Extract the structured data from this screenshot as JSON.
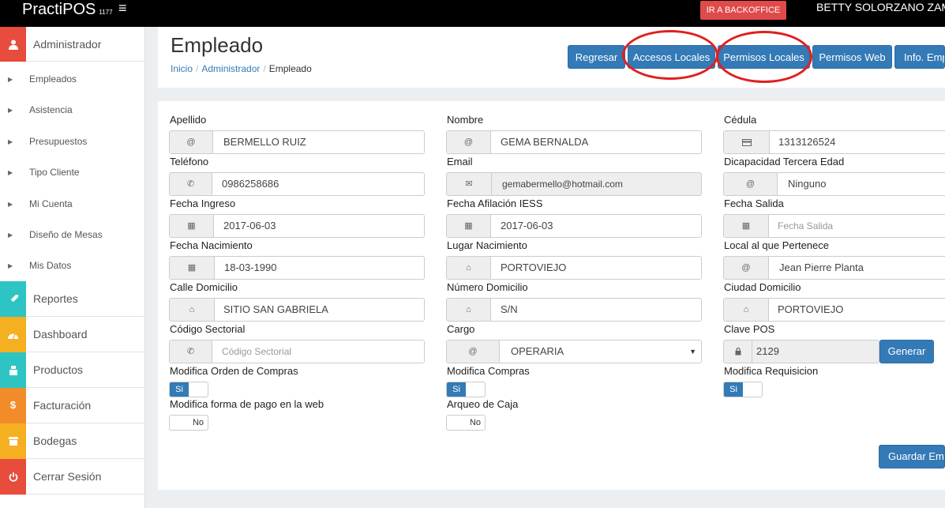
{
  "topbar": {
    "brand": "PractiPOS",
    "version": "1177",
    "menu_icon": "hamburger-icon",
    "backoffice_label": "IR A BACKOFFICE",
    "user_name": "BETTY SOLORZANO ZAM"
  },
  "sidebar": {
    "admin": {
      "label": "Administrador",
      "icon": "user-icon",
      "color": "#e74c3c"
    },
    "subitems": [
      "Empleados",
      "Asistencia",
      "Presupuestos",
      "Tipo Cliente",
      "Mi Cuenta",
      "Diseño de Mesas",
      "Mis Datos"
    ],
    "items": [
      {
        "label": "Reportes",
        "icon": "rocket-icon",
        "color": "#2ec4c4"
      },
      {
        "label": "Dashboard",
        "icon": "dashboard-icon",
        "color": "#f5b021"
      },
      {
        "label": "Productos",
        "icon": "product-icon",
        "color": "#2ec4c4"
      },
      {
        "label": "Facturación",
        "icon": "dollar-icon",
        "color": "#f28c2b"
      },
      {
        "label": "Bodegas",
        "icon": "warehouse-icon",
        "color": "#f5b021"
      },
      {
        "label": "Cerrar Sesión",
        "icon": "power-icon",
        "color": "#e74c3c"
      }
    ]
  },
  "page": {
    "title": "Empleado",
    "breadcrumb": {
      "home": "Inicio",
      "section": "Administrador",
      "current": "Empleado"
    }
  },
  "toolbar": {
    "regresar": "Regresar",
    "accesos": "Accesos Locales",
    "permisos_locales": "Permisos Locales",
    "permisos_web": "Permisos Web",
    "info": "Info. Emp"
  },
  "form": {
    "apellido": {
      "label": "Apellido",
      "value": "BERMELLO RUIZ",
      "icon": "at-icon"
    },
    "nombre": {
      "label": "Nombre",
      "value": "GEMA BERNALDA",
      "icon": "at-icon"
    },
    "cedula": {
      "label": "Cédula",
      "value": "1313126524",
      "icon": "id-card-icon"
    },
    "telefono": {
      "label": "Teléfono",
      "value": "0986258686",
      "icon": "phone-icon"
    },
    "email": {
      "label": "Email",
      "value": "gemabermello@hotmail.com",
      "icon": "envelope-icon"
    },
    "discapacidad": {
      "label": "Dicapacidad Tercera Edad",
      "value": "Ninguno",
      "icon": "at-icon"
    },
    "fecha_ingreso": {
      "label": "Fecha Ingreso",
      "value": "2017-06-03",
      "icon": "calendar-icon"
    },
    "fecha_iess": {
      "label": "Fecha Afilación IESS",
      "value": "2017-06-03",
      "icon": "calendar-icon"
    },
    "fecha_salida": {
      "label": "Fecha Salida",
      "placeholder": "Fecha Salida",
      "icon": "calendar-icon"
    },
    "fecha_nacimiento": {
      "label": "Fecha Nacimiento",
      "value": "18-03-1990",
      "icon": "calendar-icon"
    },
    "lugar_nacimiento": {
      "label": "Lugar Nacimiento",
      "value": "PORTOVIEJO",
      "icon": "home-icon"
    },
    "local": {
      "label": "Local al que Pertenece",
      "value": "Jean Pierre Planta",
      "icon": "at-icon"
    },
    "calle": {
      "label": "Calle Domicilio",
      "value": "SITIO SAN GABRIELA",
      "icon": "home-icon"
    },
    "numero": {
      "label": "Número Domicilio",
      "value": "S/N",
      "icon": "home-icon"
    },
    "ciudad": {
      "label": "Ciudad Domicilio",
      "value": "PORTOVIEJO",
      "icon": "home-icon"
    },
    "codigo_sectorial": {
      "label": "Código Sectorial",
      "placeholder": "Código Sectorial",
      "icon": "phone-icon"
    },
    "cargo": {
      "label": "Cargo",
      "value": "OPERARIA",
      "icon": "at-icon"
    },
    "clave_pos": {
      "label": "Clave POS",
      "value": "2129",
      "icon": "lock-icon",
      "button": "Generar"
    },
    "mod_orden_compras": {
      "label": "Modifica Orden de Compras",
      "on": "Si",
      "state": "on"
    },
    "mod_compras": {
      "label": "Modifica Compras",
      "on": "Si",
      "state": "on"
    },
    "mod_requisicion": {
      "label": "Modifica Requisicion",
      "on": "Si",
      "state": "on"
    },
    "mod_forma_pago": {
      "label": "Modifica forma de pago en la web",
      "off": "No",
      "state": "off"
    },
    "arqueo_caja": {
      "label": "Arqueo de Caja",
      "off": "No",
      "state": "off"
    },
    "save": "Guardar Emp"
  },
  "colors": {
    "primary": "#337ab7",
    "annotation": "#e0201f",
    "backoffice": "#e04a4a"
  }
}
